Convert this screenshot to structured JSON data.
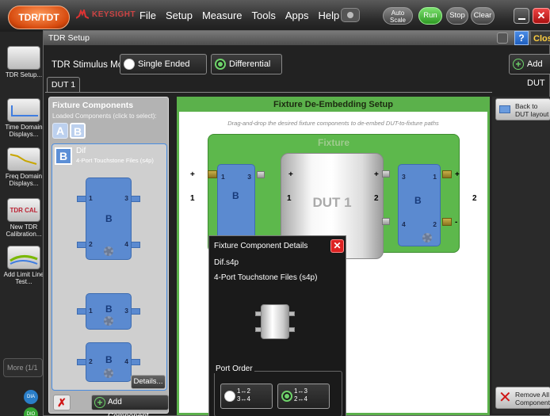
{
  "topbar": {
    "tdr_button": "TDR/TDT",
    "brand": "KEYSIGHT",
    "menus": [
      "File",
      "Setup",
      "Measure",
      "Tools",
      "Apps",
      "Help"
    ],
    "buttons": {
      "autoscale": "Auto Scale",
      "run": "Run",
      "stop": "Stop",
      "clear": "Clear"
    },
    "close_symbol": "✕"
  },
  "sidebar": {
    "items": [
      {
        "label": "TDR Setup...",
        "icon": "tdr-setup-icon"
      },
      {
        "label": "Time Domain Displays...",
        "icon": "time-domain-icon"
      },
      {
        "label": "Freq Domain Displays...",
        "icon": "freq-domain-icon"
      },
      {
        "label": "New TDR Calibration...",
        "icon": "tdr-cal-icon",
        "thumb_text": "TDR CAL"
      },
      {
        "label": "Add Limit Line Test...",
        "icon": "limit-line-icon"
      }
    ],
    "more": "More (1/1",
    "indicators": [
      "DIA",
      "DIO"
    ]
  },
  "dialog": {
    "title": "TDR Setup",
    "close_label": "Clos",
    "help_label": "?",
    "stimulus": {
      "label": "TDR Stimulus Mode:",
      "options": [
        {
          "label": "Single Ended",
          "selected": false
        },
        {
          "label": "Differential",
          "selected": true
        }
      ]
    },
    "add_dut": "Add DUT",
    "tab": "DUT 1",
    "components_panel": {
      "title": "Fixture Components",
      "subtitle": "Loaded Components (click to select):",
      "chips": [
        "A",
        "B"
      ],
      "selected": {
        "badge": "B",
        "name": "Dif",
        "desc": "4-Port Touchstone Files (s4p)"
      },
      "blocks": [
        {
          "letter": "B",
          "ports": [
            "1",
            "3",
            "2",
            "4"
          ]
        },
        {
          "letter": "B",
          "ports": [
            "1",
            "3"
          ]
        },
        {
          "letter": "B",
          "ports": [
            "2",
            "4"
          ]
        }
      ],
      "details_button": "Details...",
      "delete_button": "✗",
      "add_button": "Add Component..."
    },
    "setup_panel": {
      "title": "Fixture De-Embedding Setup",
      "hint": "Drag-and-drop the desired fixture components to de-embed DUT-to-fixture paths",
      "fixture_label": "Fixture",
      "dut_label": "DUT 1",
      "left_block": {
        "letter": "B",
        "ports": [
          "1",
          "3"
        ]
      },
      "right_block": {
        "letter": "B",
        "ports": [
          "3",
          "1",
          "4",
          "2"
        ]
      },
      "signs": [
        "+",
        "+",
        "+",
        "+",
        "-"
      ],
      "port_numbers": [
        "1",
        "1",
        "2",
        "2"
      ]
    },
    "right_panel": {
      "back_button": "Back to DUT layout",
      "remove_all": "Remove All Components"
    },
    "popup": {
      "title": "Fixture Component Details",
      "close_symbol": "✕",
      "file": "Dif.s4p",
      "desc": "4-Port Touchstone Files (s4p)",
      "port_order_label": "Port Order",
      "options": [
        {
          "line1": "1↔2",
          "line2": "3↔4",
          "selected": false
        },
        {
          "line1": "1↔3",
          "line2": "2↔4",
          "selected": true
        }
      ]
    }
  },
  "colors": {
    "accent_green": "#5bb14b",
    "block_blue": "#5b8ad0",
    "tdr_orange": "#d64a0e",
    "close_red": "#d22222"
  }
}
